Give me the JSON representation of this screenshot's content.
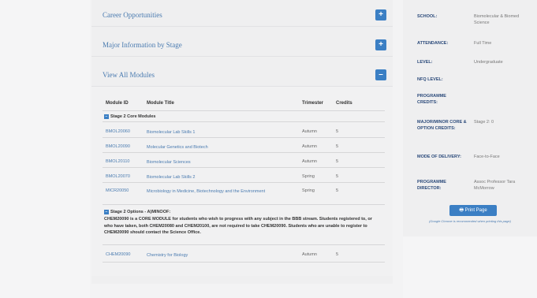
{
  "accordion": [
    {
      "title": "Career Opportunities",
      "toggle": "+"
    },
    {
      "title": "Major Information by Stage",
      "toggle": "+"
    },
    {
      "title": "View All Modules",
      "toggle": "–"
    }
  ],
  "modules": {
    "headers": {
      "id": "Module ID",
      "title": "Module Title",
      "trimester": "Trimester",
      "credits": "Credits"
    },
    "core_group": "Stage 2 Core Modules",
    "core_rows": [
      {
        "id": "BMOL20060",
        "title": "Biomolecular Lab Skills 1",
        "trimester": "Autumn",
        "credits": "5"
      },
      {
        "id": "BMOL20090",
        "title": "Molecular Genetics and Biotech",
        "trimester": "Autumn",
        "credits": "5"
      },
      {
        "id": "BMOL20110",
        "title": "Biomolecular Sciences",
        "trimester": "Autumn",
        "credits": "5"
      },
      {
        "id": "BMOL20070",
        "title": "Biomolecular Lab Skills 2",
        "trimester": "Spring",
        "credits": "5"
      },
      {
        "id": "MICR20050",
        "title": "Microbiology in Medicine, Biotechnology and the Environment",
        "trimester": "Spring",
        "credits": "5"
      }
    ],
    "options_group": "Stage 2 Options - A)MINOOF:",
    "options_note": "CHEM20090 is a CORE MODULE for students who wish to progress with any subject in the BBB stream. Students registered to, or who have taken, both CHEM20080 and CHEM20100, are not required to take CHEM20090. Students who are unable to register to CHEM20090 should contact the Science Office.",
    "option_rows": [
      {
        "id": "CHEM20090",
        "title": "Chemistry for Biology",
        "trimester": "Autumn",
        "credits": "5"
      }
    ]
  },
  "panel": {
    "rows": [
      {
        "label": "SCHOOL:",
        "value": "Biomolecular & Biomed Science"
      },
      {
        "label": "ATTENDANCE:",
        "value": "Full Time"
      },
      {
        "label": "LEVEL:",
        "value": "Undergraduate"
      },
      {
        "label": "NFQ LEVEL:",
        "value": ""
      },
      {
        "label": "PROGRAMME CREDITS:",
        "value": ""
      },
      {
        "label": "MAJOR/MINOR CORE & OPTION CREDITS:",
        "value": "Stage 2: 0"
      },
      {
        "label": "MODE OF DELIVERY:",
        "value": "Face-to-Face"
      },
      {
        "label": "PROGRAMME DIRECTOR:",
        "value": "Assoc Professor Tara McMorrow"
      }
    ],
    "print_label": "Print Page",
    "print_icon": "printer-icon",
    "print_note": "(Google Chrome is recommended when printing this page)"
  },
  "colors": {
    "accent": "#3b7fc4",
    "link": "#4a7bb0",
    "label": "#2b4a7a"
  }
}
